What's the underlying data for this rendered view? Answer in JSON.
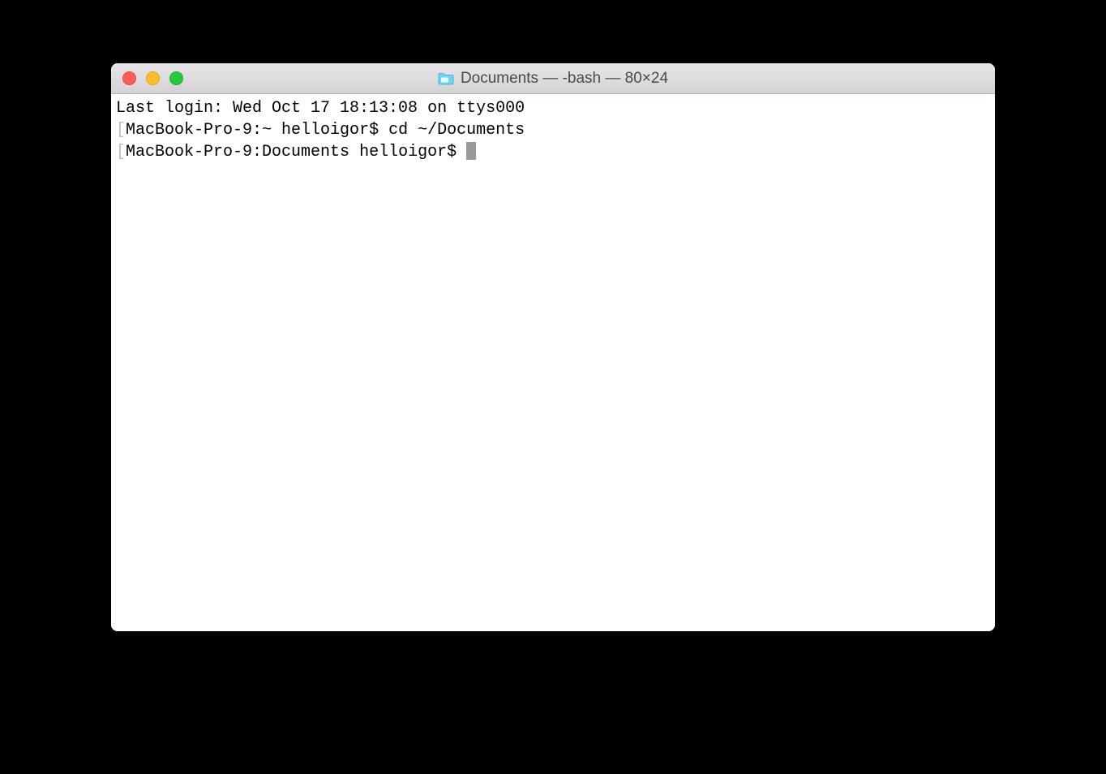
{
  "titlebar": {
    "title": "Documents — -bash — 80×24",
    "folder_icon": "folder-icon"
  },
  "terminal": {
    "last_login": "Last login: Wed Oct 17 18:13:08 on ttys000",
    "line1_prompt": "MacBook-Pro-9:~ helloigor$ ",
    "line1_command": "cd ~/Documents",
    "line2_prompt": "MacBook-Pro-9:Documents helloigor$ "
  }
}
